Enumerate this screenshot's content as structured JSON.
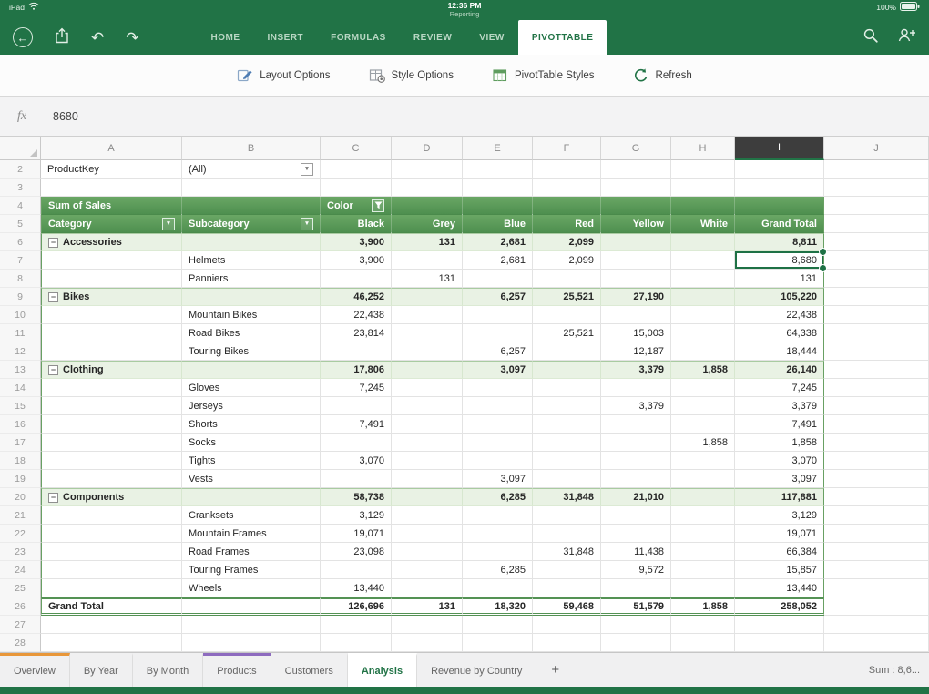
{
  "status_bar": {
    "device": "iPad",
    "time": "12:36 PM",
    "doc_title": "Reporting",
    "battery": "100%"
  },
  "ribbon": {
    "tabs": [
      {
        "label": "HOME"
      },
      {
        "label": "INSERT"
      },
      {
        "label": "FORMULAS"
      },
      {
        "label": "REVIEW"
      },
      {
        "label": "VIEW"
      },
      {
        "label": "PIVOTTABLE",
        "active": true
      }
    ]
  },
  "toolbar": {
    "buttons": [
      {
        "label": "Layout Options",
        "icon": "layout-options-icon"
      },
      {
        "label": "Style Options",
        "icon": "style-options-icon"
      },
      {
        "label": "PivotTable Styles",
        "icon": "pivottable-styles-icon"
      },
      {
        "label": "Refresh",
        "icon": "refresh-icon"
      }
    ]
  },
  "formula_bar": {
    "fx_label": "fx",
    "value": "8680"
  },
  "grid": {
    "columns": [
      "A",
      "B",
      "C",
      "D",
      "E",
      "F",
      "G",
      "H",
      "I",
      "J"
    ],
    "selected_column": "I",
    "selected_cell": "I7",
    "rows": [
      {
        "n": 2,
        "cells": [
          {
            "c": "A",
            "t": "ProductKey"
          },
          {
            "c": "B",
            "t": "(All)",
            "dd": true
          }
        ]
      },
      {
        "n": 3,
        "cells": []
      },
      {
        "n": 4,
        "type": "head",
        "cells": [
          {
            "c": "A",
            "t": "Sum of Sales"
          },
          {
            "c": "C",
            "t": "Color",
            "l": true,
            "fl": true
          }
        ]
      },
      {
        "n": 5,
        "type": "head",
        "cells": [
          {
            "c": "A",
            "t": "Category",
            "dd": true
          },
          {
            "c": "B",
            "t": "Subcategory",
            "dd": true
          },
          {
            "c": "C",
            "t": "Black"
          },
          {
            "c": "D",
            "t": "Grey"
          },
          {
            "c": "E",
            "t": "Blue"
          },
          {
            "c": "F",
            "t": "Red"
          },
          {
            "c": "G",
            "t": "Yellow"
          },
          {
            "c": "H",
            "t": "White"
          },
          {
            "c": "I",
            "t": "Grand Total"
          }
        ]
      },
      {
        "n": 6,
        "type": "cat",
        "cells": [
          {
            "c": "A",
            "t": "Accessories",
            "ex": true
          },
          {
            "c": "C",
            "t": "3,900"
          },
          {
            "c": "D",
            "t": "131"
          },
          {
            "c": "E",
            "t": "2,681"
          },
          {
            "c": "F",
            "t": "2,099"
          },
          {
            "c": "I",
            "t": "8,811"
          }
        ]
      },
      {
        "n": 7,
        "cells": [
          {
            "c": "B",
            "t": "Helmets"
          },
          {
            "c": "C",
            "t": "3,900"
          },
          {
            "c": "E",
            "t": "2,681"
          },
          {
            "c": "F",
            "t": "2,099"
          },
          {
            "c": "I",
            "t": "8,680",
            "sel": true
          }
        ]
      },
      {
        "n": 8,
        "cells": [
          {
            "c": "B",
            "t": "Panniers"
          },
          {
            "c": "D",
            "t": "131"
          },
          {
            "c": "I",
            "t": "131"
          }
        ]
      },
      {
        "n": 9,
        "type": "cat",
        "cells": [
          {
            "c": "A",
            "t": "Bikes",
            "ex": true
          },
          {
            "c": "C",
            "t": "46,252"
          },
          {
            "c": "E",
            "t": "6,257"
          },
          {
            "c": "F",
            "t": "25,521"
          },
          {
            "c": "G",
            "t": "27,190"
          },
          {
            "c": "I",
            "t": "105,220"
          }
        ]
      },
      {
        "n": 10,
        "cells": [
          {
            "c": "B",
            "t": "Mountain Bikes"
          },
          {
            "c": "C",
            "t": "22,438"
          },
          {
            "c": "I",
            "t": "22,438"
          }
        ]
      },
      {
        "n": 11,
        "cells": [
          {
            "c": "B",
            "t": "Road Bikes"
          },
          {
            "c": "C",
            "t": "23,814"
          },
          {
            "c": "F",
            "t": "25,521"
          },
          {
            "c": "G",
            "t": "15,003"
          },
          {
            "c": "I",
            "t": "64,338"
          }
        ]
      },
      {
        "n": 12,
        "cells": [
          {
            "c": "B",
            "t": "Touring Bikes"
          },
          {
            "c": "E",
            "t": "6,257"
          },
          {
            "c": "G",
            "t": "12,187"
          },
          {
            "c": "I",
            "t": "18,444"
          }
        ]
      },
      {
        "n": 13,
        "type": "cat",
        "cells": [
          {
            "c": "A",
            "t": "Clothing",
            "ex": true
          },
          {
            "c": "C",
            "t": "17,806"
          },
          {
            "c": "E",
            "t": "3,097"
          },
          {
            "c": "G",
            "t": "3,379"
          },
          {
            "c": "H",
            "t": "1,858"
          },
          {
            "c": "I",
            "t": "26,140"
          }
        ]
      },
      {
        "n": 14,
        "cells": [
          {
            "c": "B",
            "t": "Gloves"
          },
          {
            "c": "C",
            "t": "7,245"
          },
          {
            "c": "I",
            "t": "7,245"
          }
        ]
      },
      {
        "n": 15,
        "cells": [
          {
            "c": "B",
            "t": "Jerseys"
          },
          {
            "c": "G",
            "t": "3,379"
          },
          {
            "c": "I",
            "t": "3,379"
          }
        ]
      },
      {
        "n": 16,
        "cells": [
          {
            "c": "B",
            "t": "Shorts"
          },
          {
            "c": "C",
            "t": "7,491"
          },
          {
            "c": "I",
            "t": "7,491"
          }
        ]
      },
      {
        "n": 17,
        "cells": [
          {
            "c": "B",
            "t": "Socks"
          },
          {
            "c": "H",
            "t": "1,858"
          },
          {
            "c": "I",
            "t": "1,858"
          }
        ]
      },
      {
        "n": 18,
        "cells": [
          {
            "c": "B",
            "t": "Tights"
          },
          {
            "c": "C",
            "t": "3,070"
          },
          {
            "c": "I",
            "t": "3,070"
          }
        ]
      },
      {
        "n": 19,
        "cells": [
          {
            "c": "B",
            "t": "Vests"
          },
          {
            "c": "E",
            "t": "3,097"
          },
          {
            "c": "I",
            "t": "3,097"
          }
        ]
      },
      {
        "n": 20,
        "type": "cat",
        "cells": [
          {
            "c": "A",
            "t": "Components",
            "ex": true
          },
          {
            "c": "C",
            "t": "58,738"
          },
          {
            "c": "E",
            "t": "6,285"
          },
          {
            "c": "F",
            "t": "31,848"
          },
          {
            "c": "G",
            "t": "21,010"
          },
          {
            "c": "I",
            "t": "117,881"
          }
        ]
      },
      {
        "n": 21,
        "cells": [
          {
            "c": "B",
            "t": "Cranksets"
          },
          {
            "c": "C",
            "t": "3,129"
          },
          {
            "c": "I",
            "t": "3,129"
          }
        ]
      },
      {
        "n": 22,
        "cells": [
          {
            "c": "B",
            "t": "Mountain Frames"
          },
          {
            "c": "C",
            "t": "19,071"
          },
          {
            "c": "I",
            "t": "19,071"
          }
        ]
      },
      {
        "n": 23,
        "cells": [
          {
            "c": "B",
            "t": "Road Frames"
          },
          {
            "c": "C",
            "t": "23,098"
          },
          {
            "c": "F",
            "t": "31,848"
          },
          {
            "c": "G",
            "t": "11,438"
          },
          {
            "c": "I",
            "t": "66,384"
          }
        ]
      },
      {
        "n": 24,
        "cells": [
          {
            "c": "B",
            "t": "Touring Frames"
          },
          {
            "c": "E",
            "t": "6,285"
          },
          {
            "c": "G",
            "t": "9,572"
          },
          {
            "c": "I",
            "t": "15,857"
          }
        ]
      },
      {
        "n": 25,
        "cells": [
          {
            "c": "B",
            "t": "Wheels"
          },
          {
            "c": "C",
            "t": "13,440"
          },
          {
            "c": "I",
            "t": "13,440"
          }
        ]
      },
      {
        "n": 26,
        "type": "grand",
        "cells": [
          {
            "c": "A",
            "t": "Grand Total"
          },
          {
            "c": "C",
            "t": "126,696"
          },
          {
            "c": "D",
            "t": "131"
          },
          {
            "c": "E",
            "t": "18,320"
          },
          {
            "c": "F",
            "t": "59,468"
          },
          {
            "c": "G",
            "t": "51,579"
          },
          {
            "c": "H",
            "t": "1,858"
          },
          {
            "c": "I",
            "t": "258,052"
          }
        ]
      },
      {
        "n": 27,
        "cells": []
      },
      {
        "n": 28,
        "cells": []
      }
    ]
  },
  "sheet_bar": {
    "tabs": [
      {
        "label": "Overview",
        "color": "#e8973a"
      },
      {
        "label": "By Year"
      },
      {
        "label": "By Month"
      },
      {
        "label": "Products",
        "color": "#8e6bbf"
      },
      {
        "label": "Customers"
      },
      {
        "label": "Analysis",
        "active": true
      },
      {
        "label": "Revenue by Country"
      }
    ],
    "add_label": "+",
    "status": "Sum : 8,6..."
  },
  "colors": {
    "brand_green": "#217346",
    "pivot_header_green": "#5a9b5b",
    "category_row_green": "#e9f2e4",
    "selection_green": "#1e7145"
  }
}
